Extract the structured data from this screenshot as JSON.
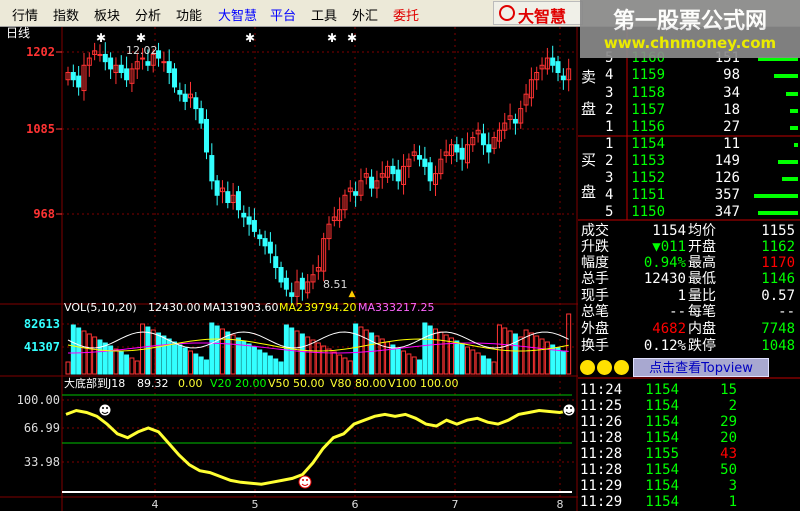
{
  "menu": {
    "items": [
      {
        "label": "行情",
        "tone": "black"
      },
      {
        "label": "指数",
        "tone": "black"
      },
      {
        "label": "板块",
        "tone": "black"
      },
      {
        "label": "分析",
        "tone": "black"
      },
      {
        "label": "功能",
        "tone": "black"
      },
      {
        "label": "大智慧",
        "tone": "blue"
      },
      {
        "label": "平台",
        "tone": "blue"
      },
      {
        "label": "工具",
        "tone": "black"
      },
      {
        "label": "外汇",
        "tone": "black"
      },
      {
        "label": "委托",
        "tone": "red"
      }
    ],
    "logo_text": "大智慧"
  },
  "watermark": {
    "line1": "第一股票公式网",
    "line2": "www.chnmoney.com"
  },
  "chart": {
    "period_label": "日线",
    "price_ticks": [
      "1202",
      "1085",
      "968"
    ],
    "high_label": "12.02",
    "low_label": "8.51",
    "volume_legend": {
      "name": "VOL(5,10,20)",
      "vol": "12430.00",
      "ma1_label": "MA1",
      "ma1": "31903.60",
      "ma2_label": "MA2",
      "ma2": "39794.20",
      "ma3_label": "MA3",
      "ma3": "33217.25"
    },
    "volume_ticks": [
      "82613",
      "41307"
    ],
    "indicator_legend": {
      "name": "大底部到J18",
      "value": "89.32",
      "zero": "0.00",
      "v20": "V20 20.00",
      "v50": "V50 50.00",
      "v80": "V80 80.00",
      "v100": "V100 100.00"
    },
    "indicator_ticks": [
      "100.00",
      "66.99",
      "33.98"
    ],
    "x_ticks": [
      "4",
      "5",
      "6",
      "7",
      "8"
    ],
    "indicator_curve": [
      80,
      84,
      82,
      78,
      70,
      60,
      56,
      62,
      66,
      62,
      50,
      38,
      28,
      22,
      20,
      16,
      12,
      10,
      9,
      8,
      10,
      12,
      14,
      18,
      30,
      45,
      56,
      60,
      70,
      74,
      78,
      80,
      78,
      80,
      76,
      70,
      68,
      74,
      70,
      74,
      76,
      72,
      70,
      74,
      80,
      82,
      84,
      83,
      82,
      84
    ],
    "colors": {
      "up": "#ff3333",
      "down": "#33ffff",
      "ma1": "#ffffff",
      "ma2": "#ffff00",
      "ma3": "#ff00ff",
      "indicator": "#ffff33",
      "grid": "#800000"
    }
  },
  "quote": {
    "sell_side_label": [
      "卖",
      "盘"
    ],
    "buy_side_label": [
      "买",
      "盘"
    ],
    "sell": [
      {
        "level": "5",
        "price": "1160",
        "vol": "151"
      },
      {
        "level": "4",
        "price": "1159",
        "vol": "98"
      },
      {
        "level": "3",
        "price": "1158",
        "vol": "34"
      },
      {
        "level": "2",
        "price": "1157",
        "vol": "18"
      },
      {
        "level": "1",
        "price": "1156",
        "vol": "27"
      }
    ],
    "buy": [
      {
        "level": "1",
        "price": "1154",
        "vol": "11"
      },
      {
        "level": "2",
        "price": "1153",
        "vol": "149"
      },
      {
        "level": "3",
        "price": "1152",
        "vol": "126"
      },
      {
        "level": "4",
        "price": "1151",
        "vol": "357"
      },
      {
        "level": "5",
        "price": "1150",
        "vol": "347"
      }
    ],
    "stats": [
      {
        "l1": "成交",
        "v1": "1154",
        "l2": "均价",
        "v2": "1155",
        "c1": "#ffffff",
        "c2": "#ffffff"
      },
      {
        "l1": "升跌",
        "v1": "▼011",
        "l2": "开盘",
        "v2": "1162",
        "c1": "#00ff00",
        "c2": "#00ff00"
      },
      {
        "l1": "幅度",
        "v1": "0.94%",
        "l2": "最高",
        "v2": "1170",
        "c1": "#00ff00",
        "c2": "#ff0000"
      },
      {
        "l1": "总手",
        "v1": "12430",
        "l2": "最低",
        "v2": "1146",
        "c1": "#ffffff",
        "c2": "#00ff00"
      },
      {
        "l1": "现手",
        "v1": "1",
        "l2": "量比",
        "v2": "0.57",
        "c1": "#ffffff",
        "c2": "#ffffff"
      },
      {
        "l1": "总笔",
        "v1": "--",
        "l2": "每笔",
        "v2": "--",
        "c1": "#ffffff",
        "c2": "#ffffff"
      },
      {
        "l1": "外盘",
        "v1": "4682",
        "l2": "内盘",
        "v2": "7748",
        "c1": "#ff0000",
        "c2": "#00ff00"
      },
      {
        "l1": "换手",
        "v1": "0.12%",
        "l2": "跌停",
        "v2": "1048",
        "c1": "#ffffff",
        "c2": "#00ff00"
      }
    ],
    "topview_label": "点击查看Topview",
    "trades": [
      {
        "time": "11:24",
        "price": "1154",
        "vol": "15",
        "pc": "#00ff00",
        "vc": "#00ff00"
      },
      {
        "time": "11:25",
        "price": "1154",
        "vol": "2",
        "pc": "#00ff00",
        "vc": "#00ff00"
      },
      {
        "time": "11:26",
        "price": "1154",
        "vol": "29",
        "pc": "#00ff00",
        "vc": "#00ff00"
      },
      {
        "time": "11:28",
        "price": "1154",
        "vol": "20",
        "pc": "#00ff00",
        "vc": "#00ff00"
      },
      {
        "time": "11:28",
        "price": "1155",
        "vol": "43",
        "pc": "#00ff00",
        "vc": "#ff0000"
      },
      {
        "time": "11:28",
        "price": "1154",
        "vol": "50",
        "pc": "#00ff00",
        "vc": "#00ff00"
      },
      {
        "time": "11:29",
        "price": "1154",
        "vol": "3",
        "pc": "#00ff00",
        "vc": "#00ff00"
      },
      {
        "time": "11:29",
        "price": "1154",
        "vol": "1",
        "pc": "#00ff00",
        "vc": "#00ff00"
      }
    ]
  }
}
